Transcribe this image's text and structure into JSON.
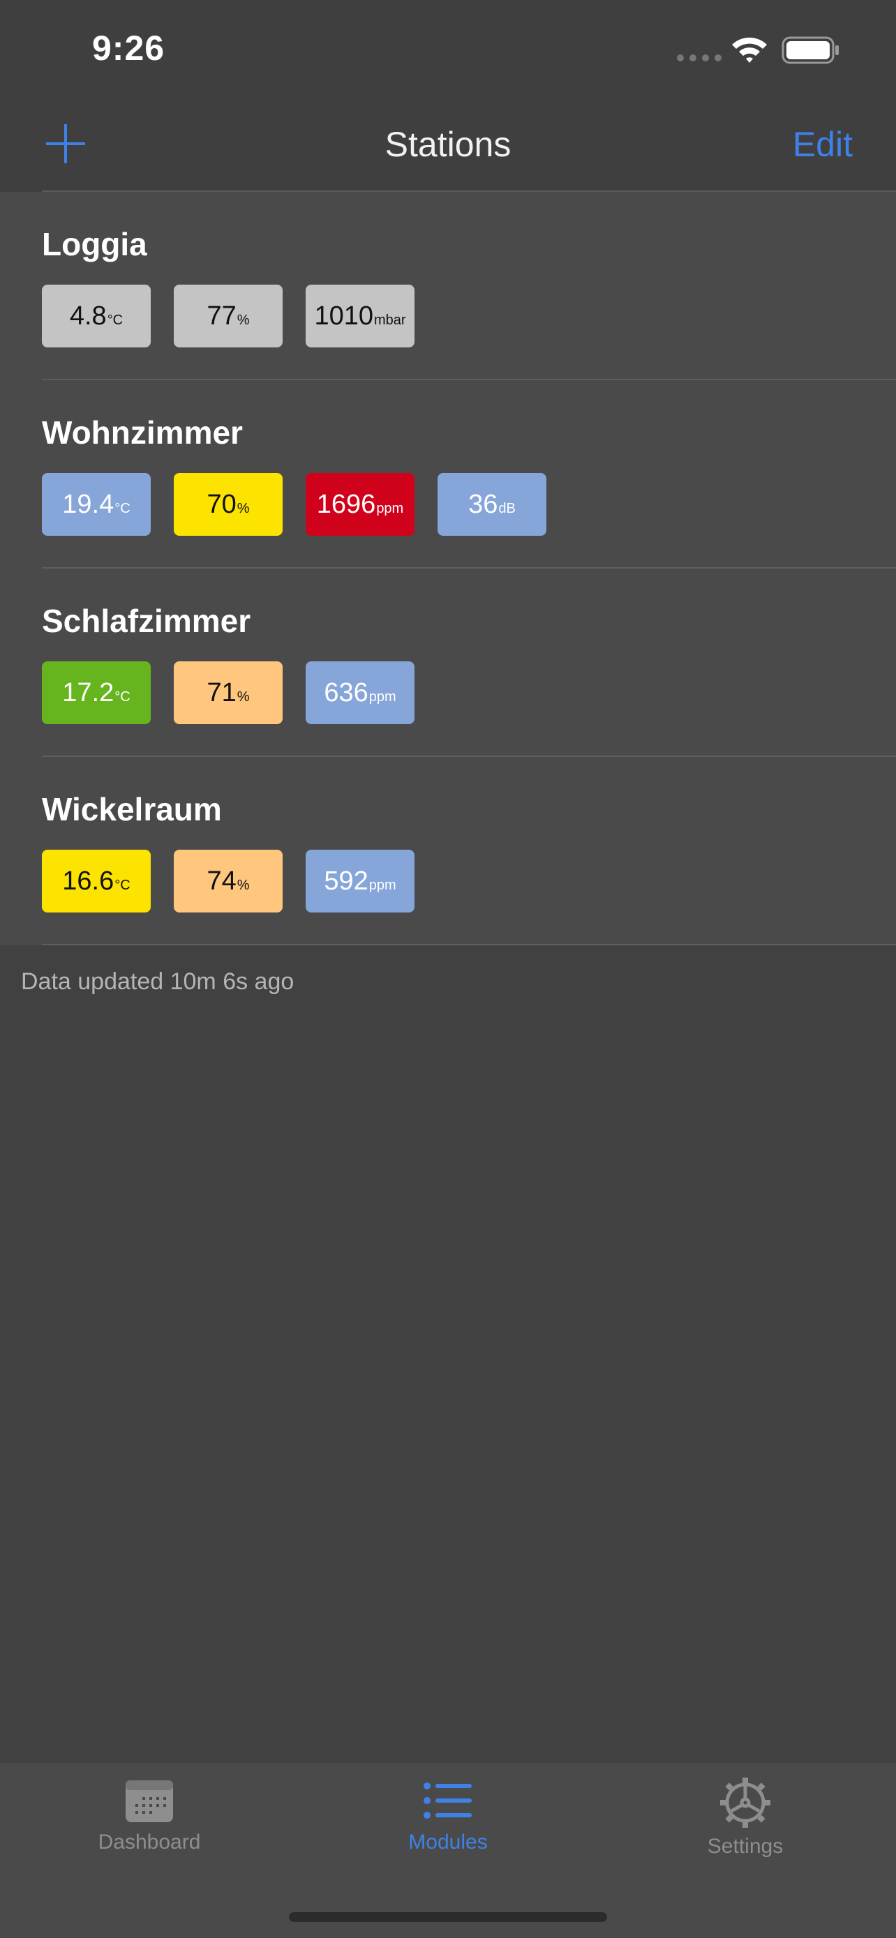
{
  "status_bar": {
    "time": "9:26"
  },
  "nav": {
    "title": "Stations",
    "edit_label": "Edit"
  },
  "stations": [
    {
      "name": "Loggia",
      "readings": [
        {
          "value": "4.8",
          "unit": "°C",
          "bg": "#c4c4c4",
          "fg": "#111111"
        },
        {
          "value": "77",
          "unit": "%",
          "bg": "#c4c4c4",
          "fg": "#111111"
        },
        {
          "value": "1010",
          "unit": "mbar",
          "bg": "#c4c4c4",
          "fg": "#111111"
        }
      ]
    },
    {
      "name": "Wohnzimmer",
      "readings": [
        {
          "value": "19.4",
          "unit": "°C",
          "bg": "#86a5d8",
          "fg": "#ffffff"
        },
        {
          "value": "70",
          "unit": "%",
          "bg": "#fde300",
          "fg": "#111111"
        },
        {
          "value": "1696",
          "unit": "ppm",
          "bg": "#d0021b",
          "fg": "#ffffff"
        },
        {
          "value": "36",
          "unit": "dB",
          "bg": "#86a5d8",
          "fg": "#ffffff"
        }
      ]
    },
    {
      "name": "Schlafzimmer",
      "readings": [
        {
          "value": "17.2",
          "unit": "°C",
          "bg": "#66b51e",
          "fg": "#ffffff"
        },
        {
          "value": "71",
          "unit": "%",
          "bg": "#ffc77d",
          "fg": "#111111"
        },
        {
          "value": "636",
          "unit": "ppm",
          "bg": "#86a5d8",
          "fg": "#ffffff"
        }
      ]
    },
    {
      "name": "Wickelraum",
      "readings": [
        {
          "value": "16.6",
          "unit": "°C",
          "bg": "#fde300",
          "fg": "#111111"
        },
        {
          "value": "74",
          "unit": "%",
          "bg": "#ffc77d",
          "fg": "#111111"
        },
        {
          "value": "592",
          "unit": "ppm",
          "bg": "#86a5d8",
          "fg": "#ffffff"
        }
      ]
    }
  ],
  "footer": {
    "updated": "Data updated 10m 6s ago"
  },
  "tabs": [
    {
      "label": "Dashboard",
      "icon": "calendar-icon",
      "active": false
    },
    {
      "label": "Modules",
      "icon": "list-icon",
      "active": true
    },
    {
      "label": "Settings",
      "icon": "gear-icon",
      "active": false
    }
  ],
  "colors": {
    "accent": "#3e82e8",
    "inactive": "#8e8e8e"
  }
}
